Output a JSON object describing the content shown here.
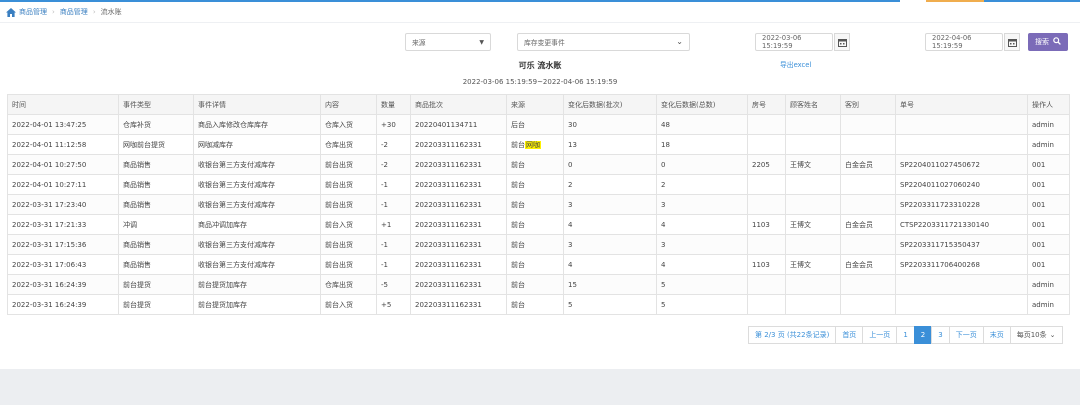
{
  "breadcrumb": {
    "items": [
      "商品管理",
      "商品管理"
    ],
    "current": "流水账"
  },
  "filters": {
    "source_placeholder": "来源",
    "event_placeholder": "库存变更事件",
    "start_date": "2022-03-06 15:19:59",
    "end_date": "2022-04-06 15:19:59",
    "search_label": "搜索"
  },
  "report": {
    "title": "可乐 流水账",
    "export_label": "导出excel",
    "range": "2022-03-06 15:19:59~2022-04-06 15:19:59"
  },
  "table": {
    "headers": [
      "时间",
      "事件类型",
      "事件详情",
      "内容",
      "数量",
      "商品批次",
      "来源",
      "变化后数据(批次)",
      "变化后数据(总数)",
      "房号",
      "顾客姓名",
      "客别",
      "单号",
      "操作人"
    ],
    "rows": [
      [
        "2022-04-01 13:47:25",
        "仓库补货",
        "商品入库修改仓库库存",
        "仓库入货",
        "+30",
        "20220401134711",
        "后台",
        "30",
        "48",
        "",
        "",
        "",
        "",
        "admin"
      ],
      [
        "2022-04-01 11:12:58",
        "网咖前台提货",
        "网咖减库存",
        "仓库出货",
        "-2",
        "202203311162331",
        "前台网咖",
        "13",
        "18",
        "",
        "",
        "",
        "",
        "admin"
      ],
      [
        "2022-04-01 10:27:50",
        "商品销售",
        "收银台第三方支付减库存",
        "前台出货",
        "-2",
        "202203311162331",
        "前台",
        "0",
        "0",
        "2205",
        "王博文",
        "白金会员",
        "SP2204011027450672",
        "001"
      ],
      [
        "2022-04-01 10:27:11",
        "商品销售",
        "收银台第三方支付减库存",
        "前台出货",
        "-1",
        "202203311162331",
        "前台",
        "2",
        "2",
        "",
        "",
        "",
        "SP2204011027060240",
        "001"
      ],
      [
        "2022-03-31 17:23:40",
        "商品销售",
        "收银台第三方支付减库存",
        "前台出货",
        "-1",
        "202203311162331",
        "前台",
        "3",
        "3",
        "",
        "",
        "",
        "SP2203311723310228",
        "001"
      ],
      [
        "2022-03-31 17:21:33",
        "冲调",
        "商品冲调加库存",
        "前台入货",
        "+1",
        "202203311162331",
        "前台",
        "4",
        "4",
        "1103",
        "王博文",
        "白金会员",
        "CTSP2203311721330140",
        "001"
      ],
      [
        "2022-03-31 17:15:36",
        "商品销售",
        "收银台第三方支付减库存",
        "前台出货",
        "-1",
        "202203311162331",
        "前台",
        "3",
        "3",
        "",
        "",
        "",
        "SP2203311715350437",
        "001"
      ],
      [
        "2022-03-31 17:06:43",
        "商品销售",
        "收银台第三方支付减库存",
        "前台出货",
        "-1",
        "202203311162331",
        "前台",
        "4",
        "4",
        "1103",
        "王博文",
        "白金会员",
        "SP2203311706400268",
        "001"
      ],
      [
        "2022-03-31 16:24:39",
        "前台提货",
        "前台提货加库存",
        "仓库出货",
        "-5",
        "202203311162331",
        "前台",
        "15",
        "5",
        "",
        "",
        "",
        "",
        "admin"
      ],
      [
        "2022-03-31 16:24:39",
        "前台提货",
        "前台提货加库存",
        "前台入货",
        "+5",
        "202203311162331",
        "前台",
        "5",
        "5",
        "",
        "",
        "",
        "",
        "admin"
      ]
    ]
  },
  "pagination": {
    "info": "第 2/3 页 (共22条记录)",
    "first": "首页",
    "prev": "上一页",
    "pages": [
      "1",
      "2",
      "3"
    ],
    "active_page": "2",
    "next": "下一页",
    "last": "末页",
    "per_page": "每页10条"
  },
  "colors": {
    "accent": "#3a8fd8",
    "search_button": "#7b6bb8",
    "negative": "#e53935",
    "highlight": "#fff200"
  },
  "icons": {
    "home": "home-icon",
    "calendar": "calendar-icon",
    "search": "search-icon",
    "dropdown": "chevron-down-icon"
  }
}
